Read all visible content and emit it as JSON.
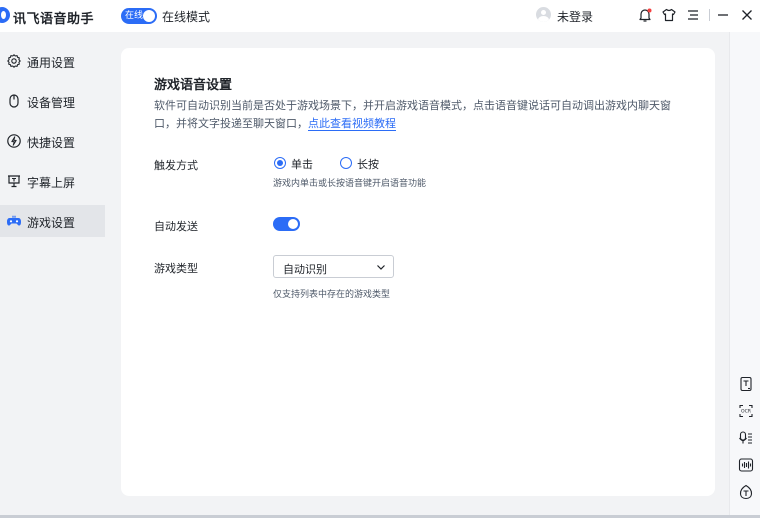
{
  "app": {
    "title": "讯飞语音助手",
    "mode_badge": "在线",
    "mode_label": "在线模式",
    "login_label": "未登录"
  },
  "sidebar": {
    "items": [
      {
        "label": "通用设置",
        "icon": "gear-icon"
      },
      {
        "label": "设备管理",
        "icon": "mouse-icon"
      },
      {
        "label": "快捷设置",
        "icon": "lightning-icon"
      },
      {
        "label": "字幕上屏",
        "icon": "subtitle-screen-icon"
      },
      {
        "label": "游戏设置",
        "icon": "gamepad-icon",
        "active": true
      }
    ]
  },
  "game_settings": {
    "title": "游戏语音设置",
    "description": "软件可自动识别当前是否处于游戏场景下，并开启游戏语音模式，点击语音键说话可自动调出游戏内聊天窗口，并将文字投递至聊天窗口，",
    "tutorial_link": "点此查看视频教程",
    "trigger": {
      "label": "触发方式",
      "options": [
        "单击",
        "长按"
      ],
      "selected": "单击",
      "hint": "游戏内单击或长按语音键开启语音功能"
    },
    "auto_send": {
      "label": "自动发送",
      "enabled": true
    },
    "game_type": {
      "label": "游戏类型",
      "value": "自动识别",
      "hint": "仅支持列表中存在的游戏类型"
    }
  },
  "rail_tools": [
    "document-text-icon",
    "ocr-icon",
    "voice-note-icon",
    "audio-wave-icon",
    "translate-icon"
  ],
  "colors": {
    "accent": "#2b6cf6",
    "background": "#f2f3f5",
    "card": "#ffffff"
  }
}
